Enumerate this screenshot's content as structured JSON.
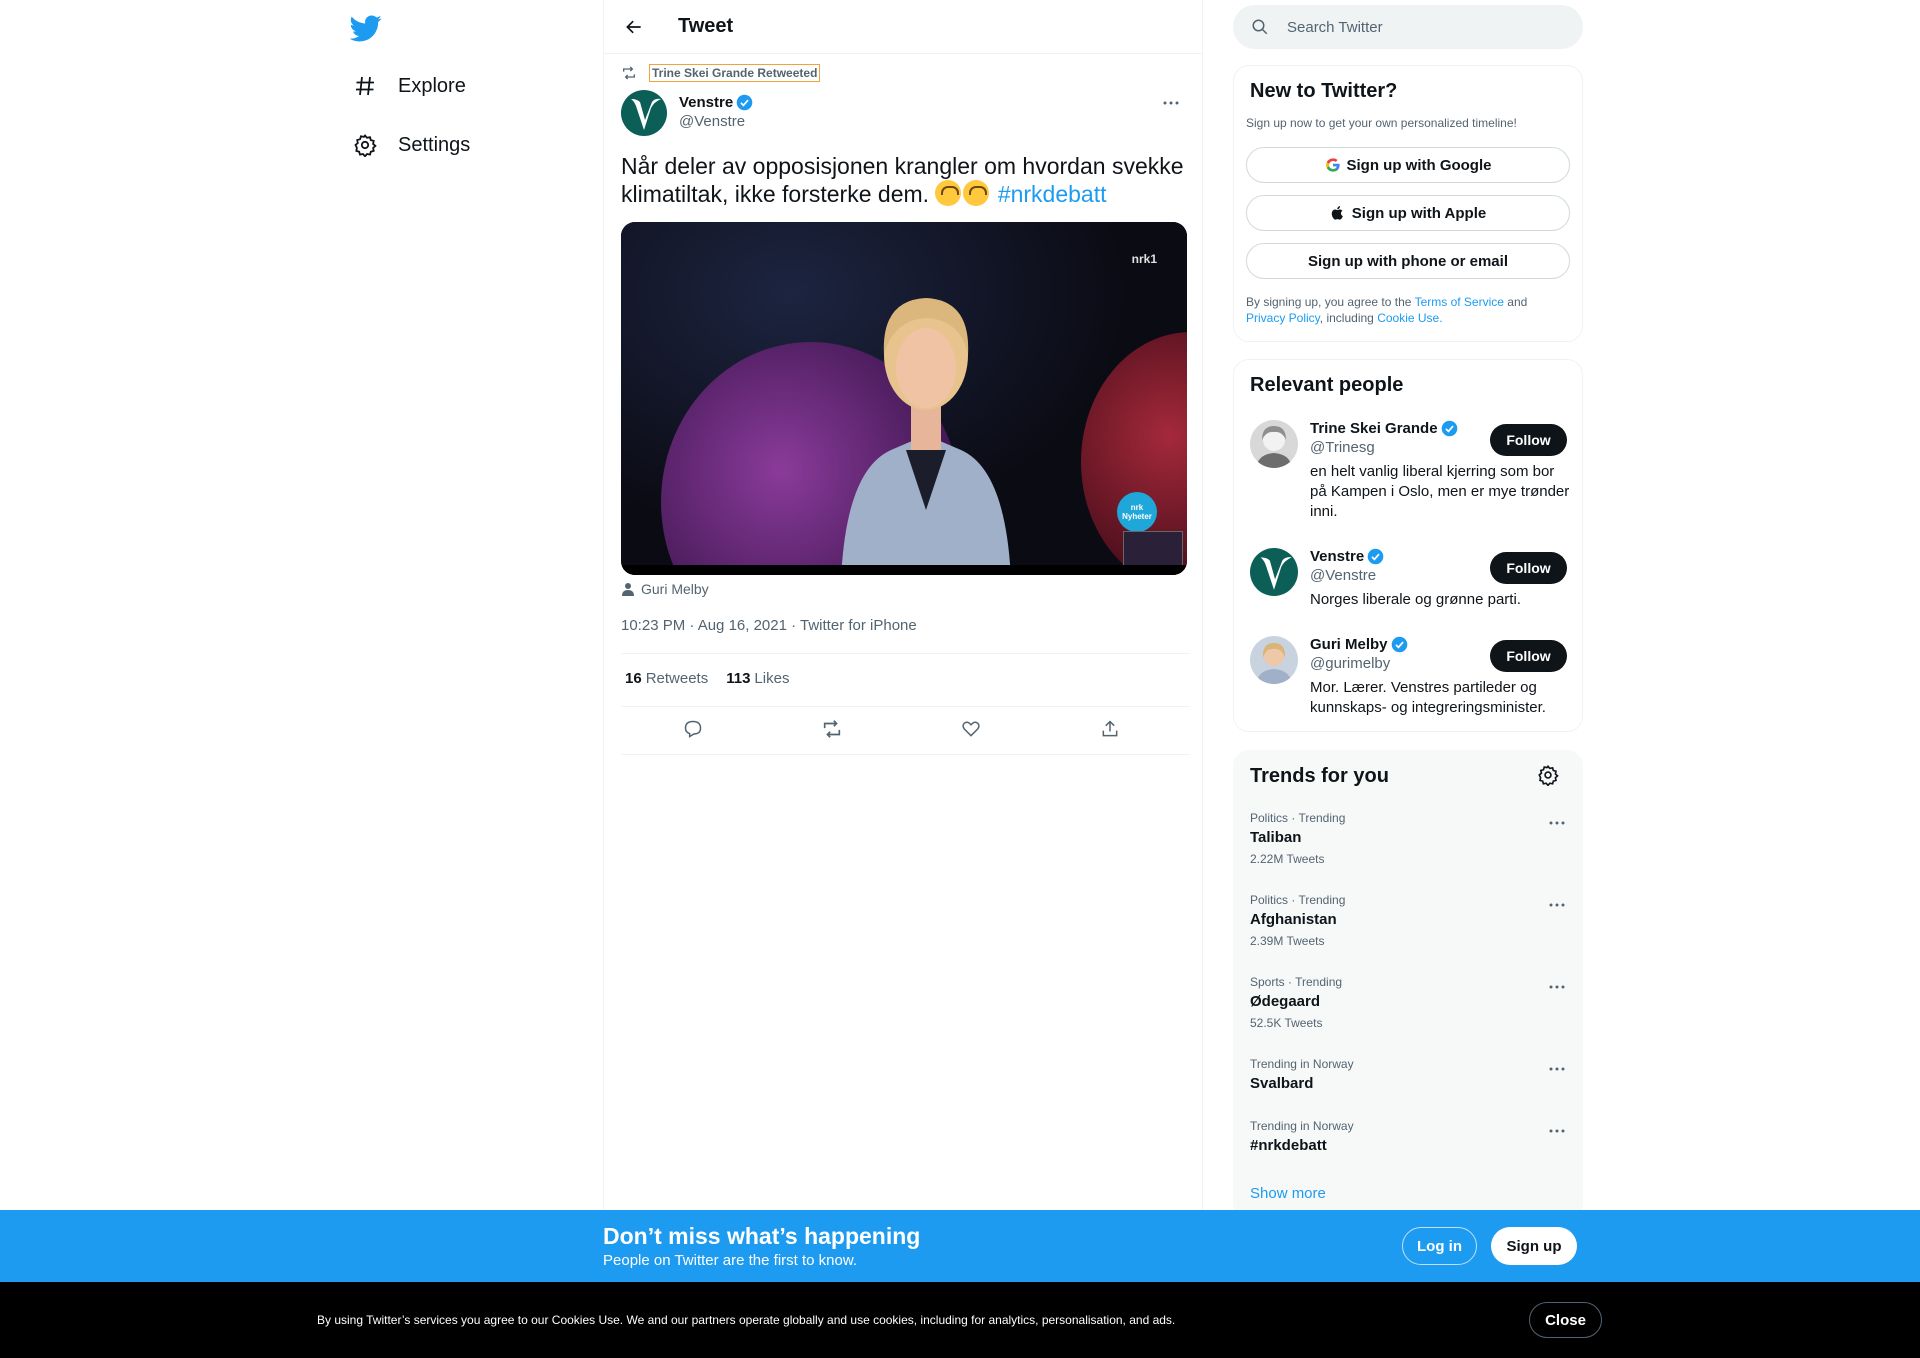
{
  "nav": {
    "explore_label": "Explore",
    "settings_label": "Settings",
    "icons": {
      "logo": "twitter-bird-icon",
      "explore": "hashtag-icon",
      "settings": "gear-icon"
    }
  },
  "header": {
    "title": "Tweet"
  },
  "tweet": {
    "retweeted_by": "Trine Skei Grande Retweeted",
    "author_name": "Venstre",
    "author_handle": "@Venstre",
    "text_main": "Når deler av opposisjonen krangler om hvordan svekke klimatiltak, ikke forsterke dem.",
    "emoji_note": "upside-down-face-emoji x2",
    "hashtag": "#nrkdebatt",
    "media_logo": "nrk1",
    "media_badge": "nrk Nyheter",
    "tagged_user": "Guri Melby",
    "timestamp": "10:23 PM · Aug 16, 2021 · Twitter for iPhone",
    "retweets_count": "16",
    "retweets_label": "Retweets",
    "likes_count": "113",
    "likes_label": "Likes"
  },
  "search": {
    "placeholder": "Search Twitter"
  },
  "new_to_twitter": {
    "title": "New to Twitter?",
    "subtitle": "Sign up now to get your own personalized timeline!",
    "google_label": "Sign up with Google",
    "apple_label": "Sign up with Apple",
    "phone_label": "Sign up with phone or email",
    "legal_prefix": "By signing up, you agree to the",
    "terms": "Terms of Service",
    "and": "and",
    "privacy": "Privacy Policy",
    "including": ", including",
    "cookie": "Cookie Use."
  },
  "relevant": {
    "title": "Relevant people",
    "people": [
      {
        "name": "Trine Skei Grande",
        "handle": "@Trinesg",
        "bio": "en helt vanlig liberal kjerring som bor på Kampen i Oslo, men er mye trønder inni.",
        "follow": "Follow"
      },
      {
        "name": "Venstre",
        "handle": "@Venstre",
        "bio": "Norges liberale og grønne parti.",
        "follow": "Follow"
      },
      {
        "name": "Guri Melby",
        "handle": "@gurimelby",
        "bio": "Mor. Lærer. Venstres partileder og kunnskaps- og integreringsminister.",
        "follow": "Follow"
      }
    ]
  },
  "trends": {
    "title": "Trends for you",
    "items": [
      {
        "category": "Politics · Trending",
        "name": "Taliban",
        "count": "2.22M Tweets"
      },
      {
        "category": "Politics · Trending",
        "name": "Afghanistan",
        "count": "2.39M Tweets"
      },
      {
        "category": "Sports · Trending",
        "name": "Ødegaard",
        "count": "52.5K Tweets"
      },
      {
        "category": "Trending in Norway",
        "name": "Svalbard",
        "count": ""
      },
      {
        "category": "Trending in Norway",
        "name": "#nrkdebatt",
        "count": ""
      }
    ],
    "show_more": "Show more"
  },
  "banner": {
    "title": "Don’t miss what’s happening",
    "subtitle": "People on Twitter are the first to know.",
    "login": "Log in",
    "signup": "Sign up"
  },
  "cookie": {
    "text": "By using Twitter’s services you agree to our Cookies Use. We and our partners operate globally and use cookies, including for analytics, personalisation, and ads.",
    "close": "Close"
  },
  "colors": {
    "accent": "#1d9bf0",
    "text": "#0f1419",
    "muted": "#536471",
    "banner": "#1d9bf0"
  }
}
